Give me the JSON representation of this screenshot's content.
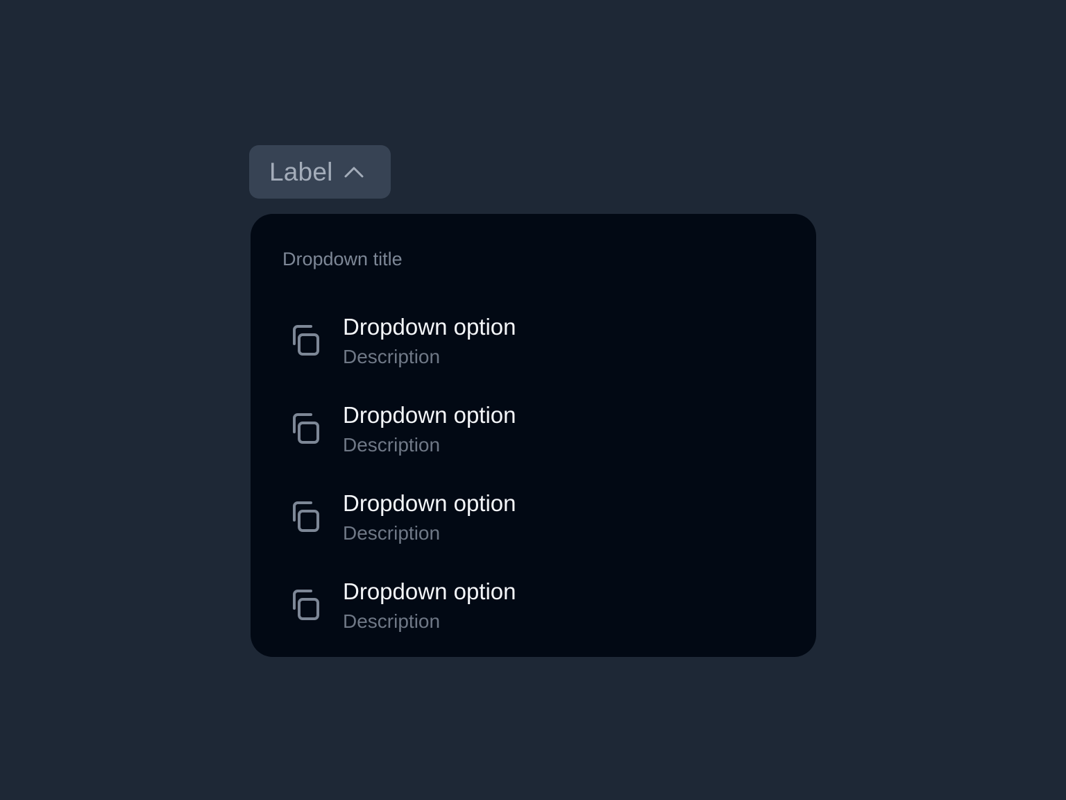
{
  "trigger": {
    "label": "Label",
    "icon": "chevron-up-icon",
    "expanded": true
  },
  "dropdown": {
    "title": "Dropdown title",
    "options": [
      {
        "label": "Dropdown option",
        "description": "Description",
        "icon": "copy-icon"
      },
      {
        "label": "Dropdown option",
        "description": "Description",
        "icon": "copy-icon"
      },
      {
        "label": "Dropdown option",
        "description": "Description",
        "icon": "copy-icon"
      },
      {
        "label": "Dropdown option",
        "description": "Description",
        "icon": "copy-icon"
      }
    ]
  },
  "colors": {
    "background": "#1e2836",
    "trigger_background": "#374354",
    "trigger_text": "#a4adba",
    "menu_background": "#020914",
    "option_text": "#f4f6f9",
    "muted_text": "#6f7886",
    "icon_stroke": "#7d8796"
  }
}
